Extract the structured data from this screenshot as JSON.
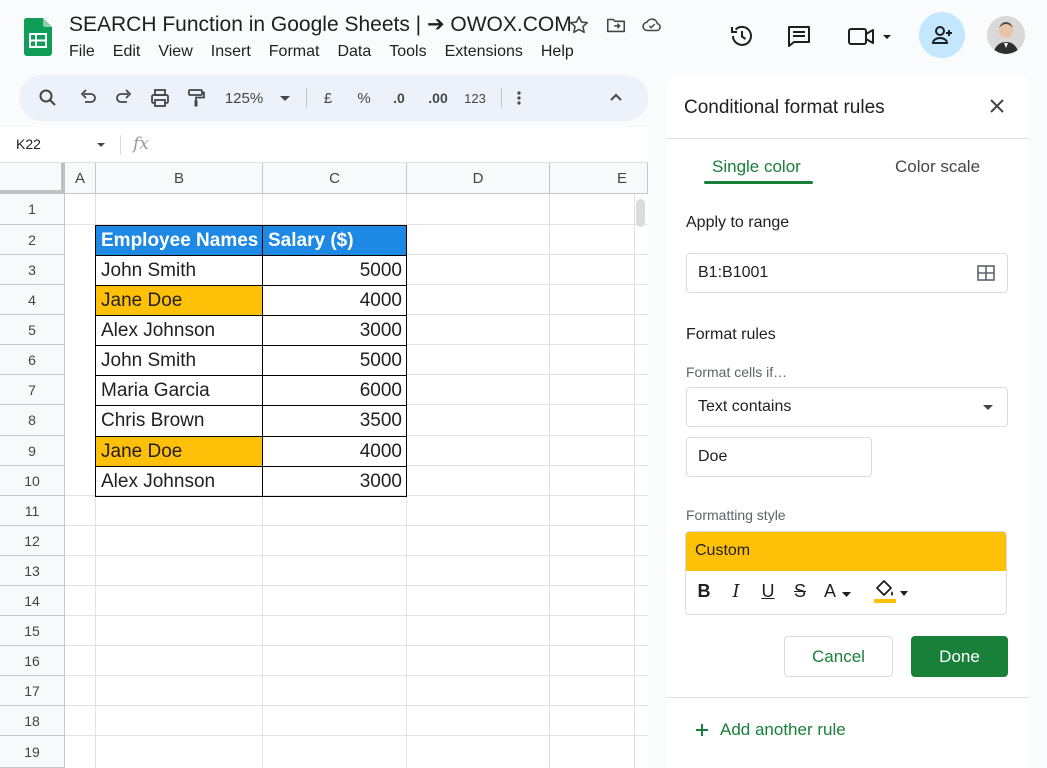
{
  "app": {
    "title": "SEARCH Function in Google Sheets | ➔ OWOX.COM",
    "menu": [
      "File",
      "Edit",
      "View",
      "Insert",
      "Format",
      "Data",
      "Tools",
      "Extensions",
      "Help"
    ],
    "brand_color": "#188038"
  },
  "toolbar": {
    "zoom": "125%",
    "currency": "£",
    "percent": "%",
    "dec_decrease": ".0",
    "dec_increase": ".00",
    "number_format": "123"
  },
  "formula_bar": {
    "cell_ref": "K22",
    "fx_label": "fx"
  },
  "grid": {
    "columns": [
      "A",
      "B",
      "C",
      "D",
      "E"
    ],
    "rows": [
      "1",
      "2",
      "3",
      "4",
      "5",
      "6",
      "7",
      "8",
      "9",
      "10",
      "11",
      "12",
      "13",
      "14",
      "15",
      "16",
      "17",
      "18",
      "19"
    ],
    "header": {
      "name": "Employee Names",
      "salary": "Salary ($)"
    },
    "header_color": "#1e88e5",
    "highlight_color": "#ffc107",
    "data": [
      {
        "name": "John Smith",
        "salary": "5000",
        "highlight": false
      },
      {
        "name": "Jane Doe",
        "salary": "4000",
        "highlight": true
      },
      {
        "name": "Alex Johnson",
        "salary": "3000",
        "highlight": false
      },
      {
        "name": "John Smith",
        "salary": "5000",
        "highlight": false
      },
      {
        "name": "Maria Garcia",
        "salary": "6000",
        "highlight": false
      },
      {
        "name": "Chris Brown",
        "salary": "3500",
        "highlight": false
      },
      {
        "name": "Jane Doe",
        "salary": "4000",
        "highlight": true
      },
      {
        "name": "Alex Johnson",
        "salary": "3000",
        "highlight": false
      }
    ]
  },
  "panel": {
    "title": "Conditional format rules",
    "tabs": {
      "single": "Single color",
      "scale": "Color scale"
    },
    "apply_label": "Apply to range",
    "range_value": "B1:B1001",
    "format_rules_label": "Format rules",
    "condition_label": "Format cells if…",
    "condition_value": "Text contains",
    "condition_input": "Doe",
    "style_label": "Formatting style",
    "style_preview": "Custom",
    "style_color": "#ffc107",
    "format_buttons": {
      "bold": "B",
      "italic": "I",
      "underline": "U",
      "strike": "S",
      "text_color": "A"
    },
    "cancel": "Cancel",
    "done": "Done",
    "add_rule": "Add another rule"
  }
}
